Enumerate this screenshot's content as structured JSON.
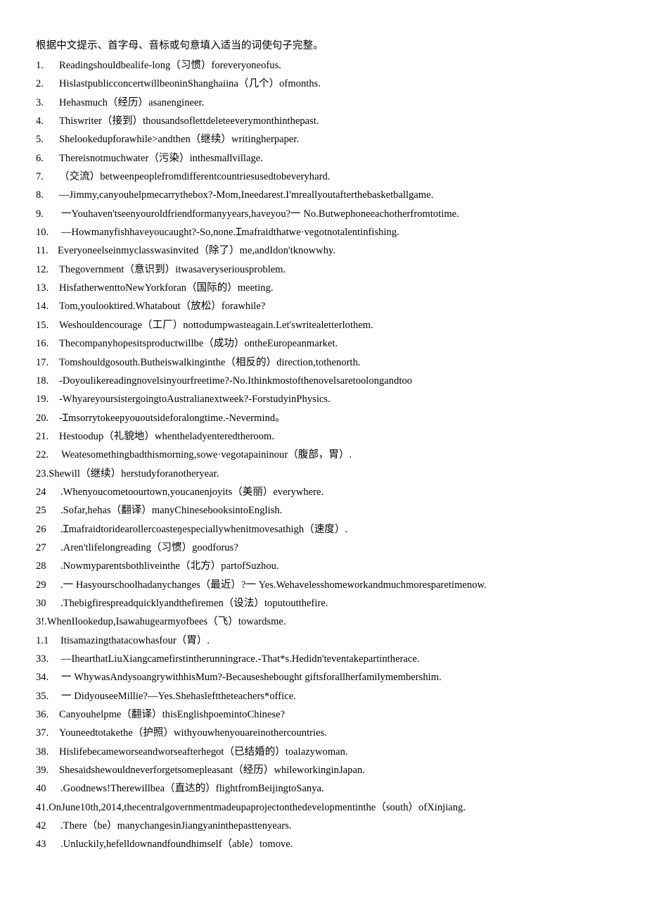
{
  "document": {
    "heading": "根据中文提示、首字母、音标或句意填入适当的词使句子完整。",
    "items": [
      {
        "num": "1.",
        "text": "Readingshouldbealife-long（习惯）foreveryoneofus.",
        "style": "dot",
        "indent": 1
      },
      {
        "num": "2.",
        "text": "HislastpublicconcertwillbeoninShanghaiina（几个）ofmonths.",
        "style": "dot",
        "indent": 1
      },
      {
        "num": "3.",
        "text": "Hehasmuch（经历）asanengineer.",
        "style": "dot",
        "indent": 1
      },
      {
        "num": "4.",
        "text": "Thiswriter（接到）thousandsoflettdeleteeverymonthinthepast.",
        "style": "dot",
        "indent": 1
      },
      {
        "num": "5.",
        "text": "Shelookedupforawhile>andthen（继续）writingherpaper.",
        "style": "dot",
        "indent": 1
      },
      {
        "num": "6.",
        "text": "Thereisnotmuchwater（污染）inthesmallvillage.",
        "style": "dot",
        "indent": 1
      },
      {
        "num": "7.",
        "text": "（交流）betweenpeoplefromdifferentcountriesusedtobeveryhard.",
        "style": "dot",
        "indent": 1
      },
      {
        "num": "8.",
        "text": "—Jimmy,canyouhelpmecarrythebox?-Mom,Ineedarest.I'mreallyoutafterthebasketballgame.",
        "style": "dot",
        "indent": 1
      },
      {
        "num": "9.",
        "text": "一Youhaven'tseenyouroldfriendformanyyears,haveyou?一 No.Butwephoneeachotherfromtotime.",
        "style": "dot",
        "indent": 2
      },
      {
        "num": "10.",
        "text": "—Howmanyfishhaveyoucaught?-So,none.Ɪmafraidthatwe·vegotnotalentinfishing.",
        "style": "dot",
        "indent": 2
      },
      {
        "num": "11.",
        "text": "Everyoneelseinmyclasswasinvited（除了）me,andIdon'tknowwhy.",
        "style": "dot",
        "indent": 0
      },
      {
        "num": "12.",
        "text": "Thegovernment（意识到）itwasaveryseriousproblem.",
        "style": "dot",
        "indent": 1
      },
      {
        "num": "13.",
        "text": "HisfatherwenttoNewYorkforan（国际的）meeting.",
        "style": "dot",
        "indent": 1
      },
      {
        "num": "14.",
        "text": "Tom,youlooktired.Whatabout（放松）forawhile?",
        "style": "dot",
        "indent": 1
      },
      {
        "num": "15.",
        "text": "Weshouldencourage（工厂）nottodumpwasteagain.Let'swritealetterlothem.",
        "style": "dot",
        "indent": 1
      },
      {
        "num": "16.",
        "text": "Thecompanyhopesitsproductwillbe（成功）ontheEuropeanmarket.",
        "style": "dot",
        "indent": 1
      },
      {
        "num": "17.",
        "text": "Tomshouldgosouth.Butheiswalkinginthe（相反的）direction,tothenorth.",
        "style": "dot",
        "indent": 1
      },
      {
        "num": "18.",
        "text": "-Doyoulikereadingnovelsinyourfreetime?-No.Ithinkmostofthenovelsaretoolongandtoo",
        "style": "dot",
        "indent": 1
      },
      {
        "num": "19.",
        "text": "-WhyareyoursistergoingtoAustralianextweek?-ForstudyinPhysics.",
        "style": "dot",
        "indent": 1
      },
      {
        "num": "20.",
        "text": "-Ɪmsorrytokeepyououtsideforalongtime.-Nevermind。",
        "style": "dot",
        "indent": 1
      },
      {
        "num": "21.",
        "text": "Hestoodup（礼貌地）whentheladyenteredtheroom.",
        "style": "dot",
        "indent": 1
      },
      {
        "num": "22.",
        "text": "Weatesomethingbadthismorning,sowe·vegotapaininour（腹部，胃）.",
        "style": "dot",
        "indent": 2
      },
      {
        "num": "23.",
        "text": "Shewill（继续）herstudyforanotheryear.",
        "style": "run",
        "indent": 0
      },
      {
        "num": "24",
        "text": ".Whenyoucometoourtown,youcanenjoyits（美丽）everywhere.",
        "style": "bare",
        "indent": 0
      },
      {
        "num": "25",
        "text": ".Sofar,hehas（翻译）manyChinesebooksintoEnglish.",
        "style": "bare",
        "indent": 0
      },
      {
        "num": "26",
        "text": ".Ɪmafraidtoridearollercoasteŋespeciallywhenitmovesathigh（速度）.",
        "style": "bare",
        "indent": 0
      },
      {
        "num": "27",
        "text": ".Aren'tlifelongreading（习惯）goodforus?",
        "style": "bare",
        "indent": 0
      },
      {
        "num": "28",
        "text": ".Nowmyparentsbothliveinthe（北方）partofSuzhou.",
        "style": "bare",
        "indent": 0
      },
      {
        "num": "29",
        "text": ".一 Hasyourschoolhadanychanges（最近）?一 Yes.Wehavelesshomeworkandmuchmoresparetimenow.",
        "style": "bare",
        "indent": 0
      },
      {
        "num": "30",
        "text": ".Thebigfirespreadquicklyandthefiremen（设法）toputoutthefire.",
        "style": "bare",
        "indent": 0
      },
      {
        "num": "3!.",
        "text": "WhenIlookedup,Isawahugearmyofbees（飞）towardsme.",
        "style": "run",
        "indent": 0
      },
      {
        "num": "1.1",
        "text": "Itisamazingthatacowhasfour（胃）.",
        "style": "bare",
        "indent": 0
      },
      {
        "num": "33.",
        "text": "—IhearthatLiuXiangcamefirstintherunningrace.-That*s.Hedidn'teventakepartintherace.",
        "style": "dot",
        "indent": 2
      },
      {
        "num": "34.",
        "text": "一 WhywasAndysoangrywithhisMum?-Becauseshebought giftsforallherfamilymembershim.",
        "style": "dot",
        "indent": 2
      },
      {
        "num": "35.",
        "text": "一 DidyouseeMillie?—Yes.Shehaslefttheteachers*office.",
        "style": "dot",
        "indent": 2
      },
      {
        "num": "36.",
        "text": "Canyouhelpme（翻译）thisEnglishpoemintoChinese?",
        "style": "dot",
        "indent": 1
      },
      {
        "num": "37.",
        "text": "Youneedtotakethe（护照）withyouwhenyouareinothercountries.",
        "style": "dot",
        "indent": 1
      },
      {
        "num": "38.",
        "text": "Hislifebecameworseandworseafterhegot（已结婚的）toalazywoman.",
        "style": "dot",
        "indent": 1
      },
      {
        "num": "39.",
        "text": "Shesaidshewouldneverforgetsomepleasant（经历）whileworkinginJapan.",
        "style": "dot",
        "indent": 1
      },
      {
        "num": "40",
        "text": ".Goodnews!Therewillbea（直达的）flightfromBeijingtoSanya.",
        "style": "bare",
        "indent": 0
      },
      {
        "num": "41.",
        "text": "OnJune10th,2014,thecentralgovernmentmadeupaprojectonthedevelopmentinthe（south）ofXinjiang.",
        "style": "run",
        "indent": 0
      },
      {
        "num": "42",
        "text": ".There（be）manychangesinJiangyaninthepasttenyears.",
        "style": "bare",
        "indent": 0
      },
      {
        "num": "43",
        "text": ".Unluckily,hefelldownandfoundhimself（able）tomove.",
        "style": "bare",
        "indent": 0
      }
    ]
  }
}
